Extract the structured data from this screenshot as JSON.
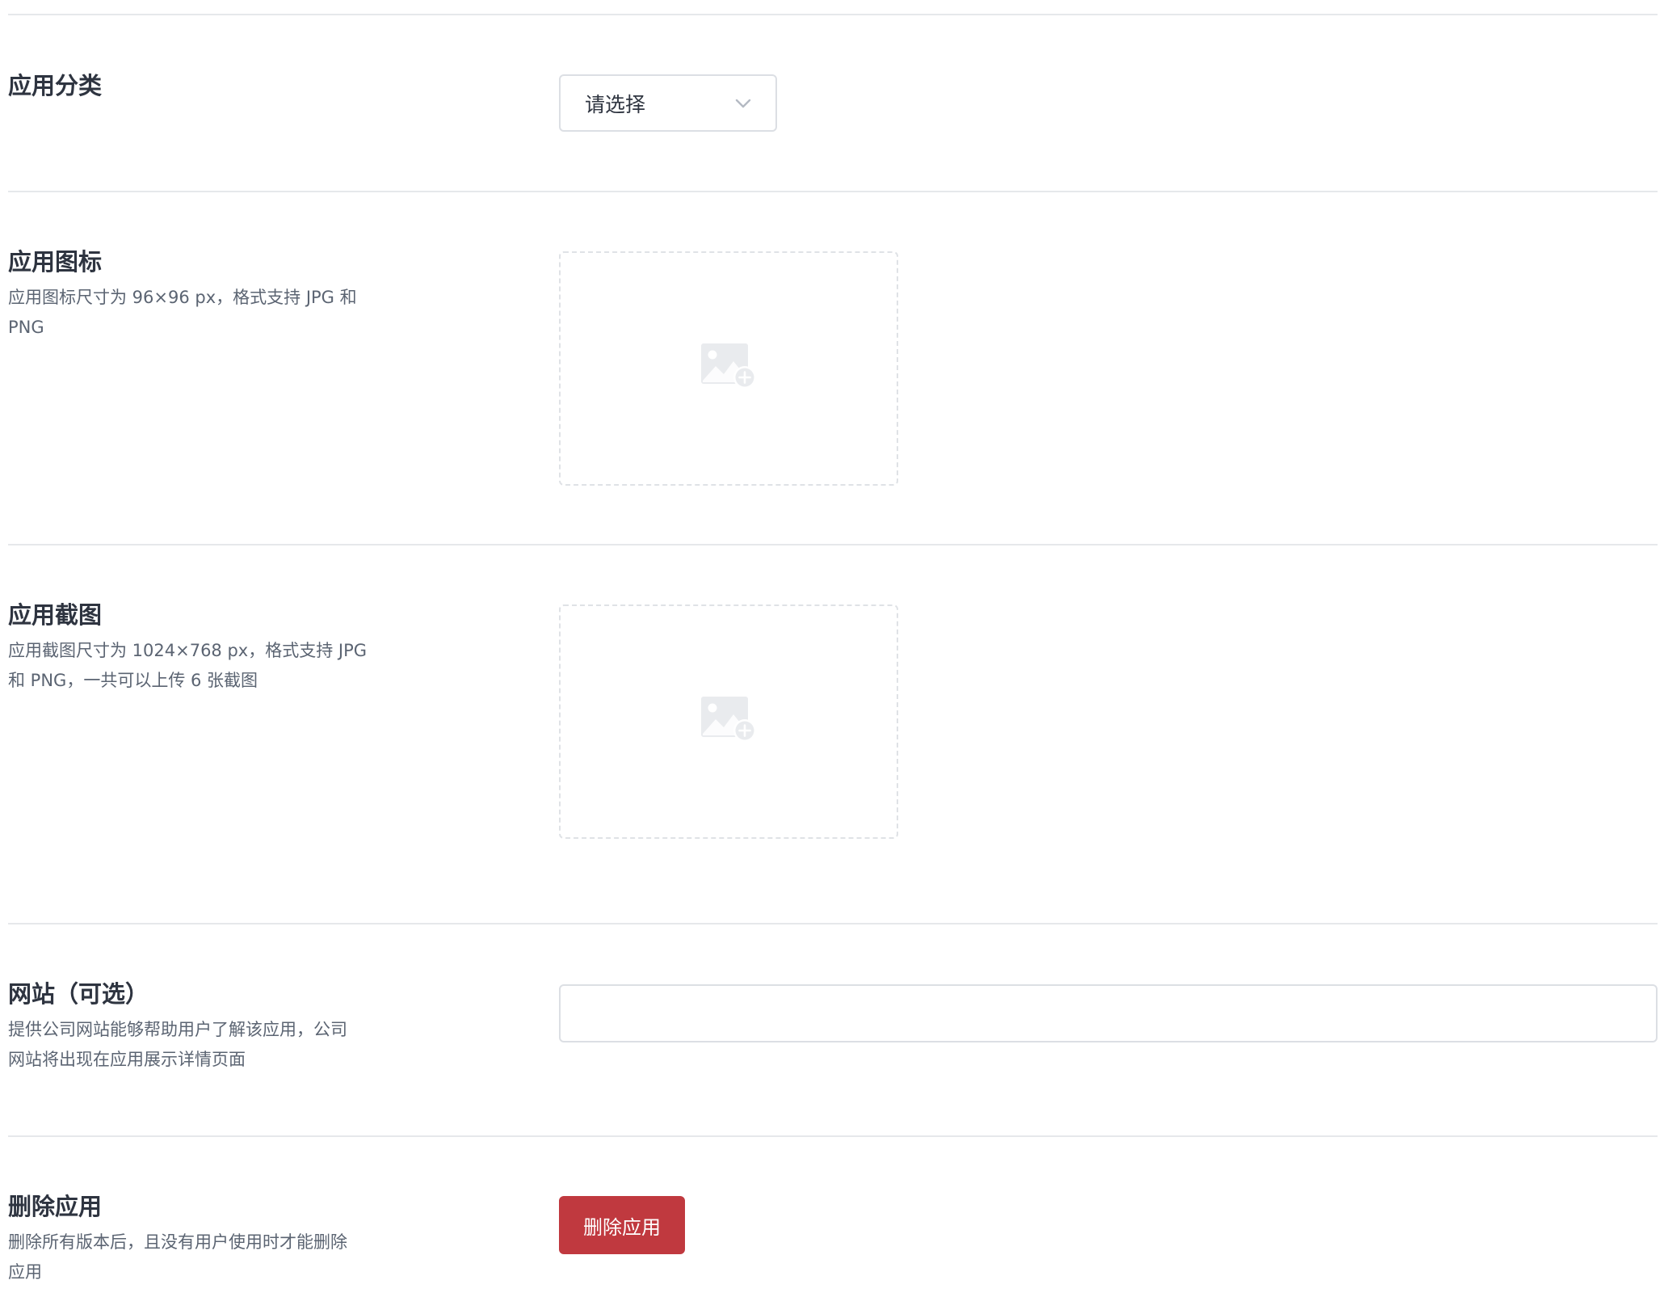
{
  "category": {
    "title": "应用分类",
    "select": {
      "value": "请选择",
      "icon": "chevron-down-icon"
    }
  },
  "app_icon": {
    "title": "应用图标",
    "desc_line1": "应用图标尺寸为 96×96 px，格式支持 JPG 和",
    "desc_line2": "PNG",
    "upload_icon": "image-add-icon"
  },
  "screenshots": {
    "title": "应用截图",
    "desc_line1": "应用截图尺寸为 1024×768 px，格式支持 JPG",
    "desc_line2": "和 PNG，一共可以上传 6 张截图",
    "upload_icon": "image-add-icon"
  },
  "website": {
    "title": "网站（可选）",
    "desc_line1": "提供公司网站能够帮助用户了解该应用，公司",
    "desc_line2": "网站将出现在应用展示详情页面",
    "input_value": "",
    "input_placeholder": ""
  },
  "delete_app": {
    "title": "删除应用",
    "desc_line1": "删除所有版本后，且没有用户使用时才能删除",
    "desc_line2": "应用",
    "button_label": "删除应用",
    "button_color": "#c0393f"
  },
  "colors": {
    "divider": "#e6e8eb",
    "border": "#dcdfe4",
    "title_text": "#2e3440",
    "desc_text": "#5b6472"
  }
}
